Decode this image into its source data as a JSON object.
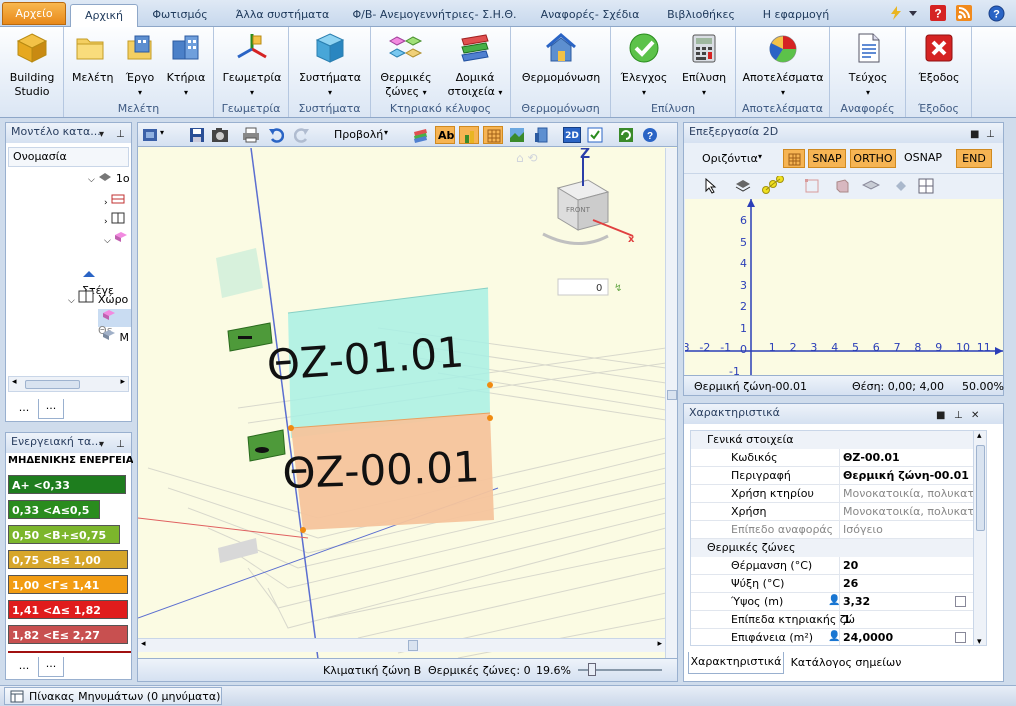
{
  "tabs": {
    "app": "Αρχείο",
    "items": [
      "Αρχική",
      "Φωτισμός",
      "Άλλα συστήματα",
      "Φ/Β- Ανεμογεννήτριες- Σ.Η.Θ.",
      "Αναφορές- Σχέδια",
      "Βιβλιοθήκες",
      "Η εφαρμογή"
    ]
  },
  "ribbon": {
    "building_studio": "Building Studio",
    "meleti": "Μελέτη",
    "ergo": "Έργο",
    "ktiria": "Κτήρια",
    "group_meleti": "Μελέτη",
    "geometria": "Γεωμετρία",
    "group_geometria": "Γεωμετρία",
    "systimata": "Συστήματα",
    "group_systimata": "Συστήματα",
    "thermikes_zones": "Θερμικές ζώνες",
    "domika_stoixeia": "Δομικά στοιχεία",
    "group_kelyfos": "Κτηριακό κέλυφος",
    "thermomonosi": "Θερμομόνωση",
    "group_thermomonosi": "Θερμομόνωση",
    "elegxos": "Έλεγχος",
    "epilysi": "Επίλυση",
    "group_epilysi": "Επίλυση",
    "apotelesmata": "Αποτελέσματα",
    "group_apotelesmata": "Αποτελέσματα",
    "teuxos": "Τεύχος",
    "group_anafores": "Αναφορές",
    "exodos": "Έξοδος",
    "group_exodos": "Έξοδος"
  },
  "model_panel": {
    "title": "Μοντέλο κατα...",
    "column": "Ονομασία",
    "tree_item_1": "1ο",
    "tree_item_roof": "Στέγε",
    "tree_item_spaces": "Χώρο",
    "tree_item_th": "Θε",
    "tree_item_m": "Μ",
    "ellipsis_1": "...",
    "ellipsis_2": "..."
  },
  "energy_panel": {
    "title": "Ενεργειακή τα...",
    "header": "ΜΗΔΕΝΙΚΗΣ ΕΝΕΡΓΕΙΑΚΗ",
    "classes": [
      {
        "label": "A+ <0,33",
        "color": "#1e7d1e"
      },
      {
        "label": "0,33 <A≤0,5",
        "color": "#2a8c1e"
      },
      {
        "label": "0,50 <B+≤0,75",
        "color": "#7cb62c"
      },
      {
        "label": "0,75 <B≤ 1,00",
        "color": "#d7a62a"
      },
      {
        "label": "1,00 <Γ≤ 1,41",
        "color": "#f29c12"
      },
      {
        "label": "1,41 <Δ≤ 1,82",
        "color": "#e01c1c"
      },
      {
        "label": "1,82 <E≤ 2,27",
        "color": "#c85050"
      }
    ],
    "ellipsis_1": "...",
    "ellipsis_2": "..."
  },
  "viewport": {
    "view_menu": "Προβολή",
    "zone_upper": "ΘΖ-01.01",
    "zone_lower": "ΘΖ-00.01",
    "angle_value": "0",
    "status_climate": "Κλιματική ζώνη B",
    "status_zones": "Θερμικές ζώνες: 0",
    "status_zoom": "19.6%"
  },
  "edit2d": {
    "title": "Επεξεργασία 2D",
    "orientation": "Οριζόντια",
    "snap": "SNAP",
    "ortho": "ORTHO",
    "osnap": "OSNAP",
    "end": "END",
    "y_labels": [
      "6",
      "5",
      "4",
      "3",
      "2",
      "1",
      "0",
      "-1"
    ],
    "x_labels": [
      "-3",
      "-2",
      "-1",
      "0",
      "1",
      "2",
      "3",
      "4",
      "5",
      "6",
      "7",
      "8",
      "9",
      "10",
      "11"
    ],
    "status_zone": "Θερμική ζώνη-00.01",
    "status_pos": "Θέση: 0,00; 4,00",
    "status_zoom": "50.00%"
  },
  "properties": {
    "title": "Χαρακτηριστικά",
    "section_general": "Γενικά στοιχεία",
    "section_zones": "Θερμικές ζώνες",
    "rows_general": [
      {
        "key": "Κωδικός",
        "value": "ΘΖ-00.01"
      },
      {
        "key": "Περιγραφή",
        "value": "Θερμική ζώνη-00.01"
      },
      {
        "key": "Χρήση κτηρίου",
        "value": "Μονοκατοικία, πολυκατ..."
      },
      {
        "key": "Χρήση",
        "value": "Μονοκατοικία, πολυκατ..."
      },
      {
        "key": "Επίπεδο αναφοράς",
        "value": "Ισόγειο"
      }
    ],
    "rows_zones": [
      {
        "key": "Θέρμανση (°C)",
        "value": "20"
      },
      {
        "key": "Ψύξη (°C)",
        "value": "26"
      },
      {
        "key": "Ύψος  (m)",
        "value": "3,32"
      },
      {
        "key": "Επίπεδα κτηριακής ζώ",
        "value": "1"
      },
      {
        "key": "Επιφάνεια (m²)",
        "value": "24,0000"
      }
    ],
    "tab_props": "Χαρακτηριστικά",
    "tab_points": "Κατάλογος σημείων"
  },
  "statusbar": {
    "messages": "Πίνακας Μηνυμάτων (0 μηνύματα)"
  }
}
